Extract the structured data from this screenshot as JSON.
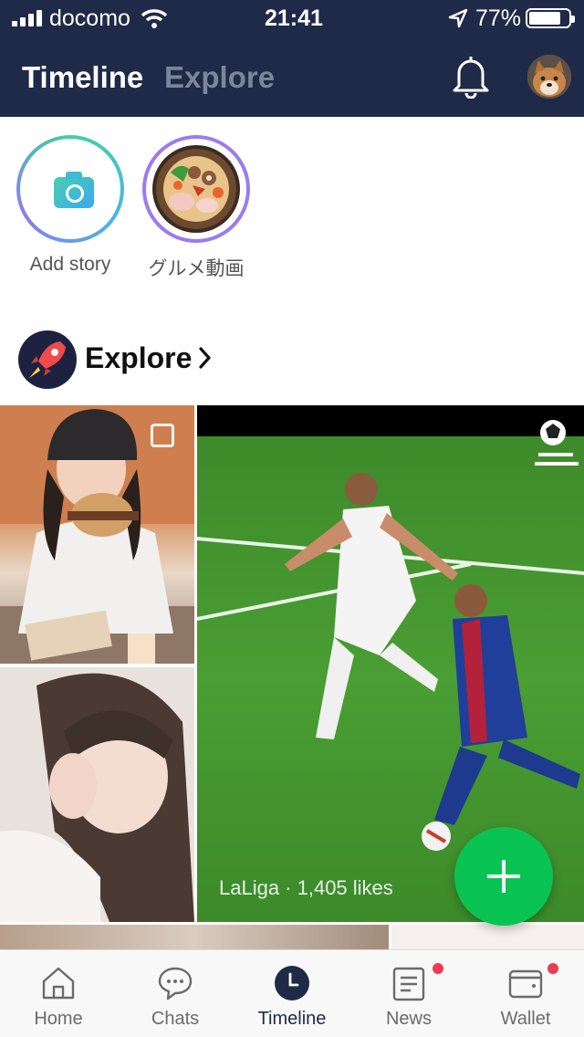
{
  "status_bar": {
    "carrier": "docomo",
    "time": "21:41",
    "battery": "77%"
  },
  "header": {
    "tabs": [
      "Timeline",
      "Explore"
    ],
    "active_tab": "Timeline"
  },
  "stories": [
    {
      "label": "Add story"
    },
    {
      "label": "グルメ動画"
    }
  ],
  "explore": {
    "title": "Explore"
  },
  "grid": {
    "video_caption": "LaLiga · 1,405 likes"
  },
  "tabbar": {
    "items": [
      {
        "label": "Home",
        "badge": false
      },
      {
        "label": "Chats",
        "badge": false
      },
      {
        "label": "Timeline",
        "badge": false,
        "active": true
      },
      {
        "label": "News",
        "badge": true
      },
      {
        "label": "Wallet",
        "badge": true
      }
    ]
  },
  "colors": {
    "header_bg": "#1f2a48",
    "fab": "#09c453",
    "badge": "#f03a4f",
    "story_ring": "#9b7bf1"
  }
}
